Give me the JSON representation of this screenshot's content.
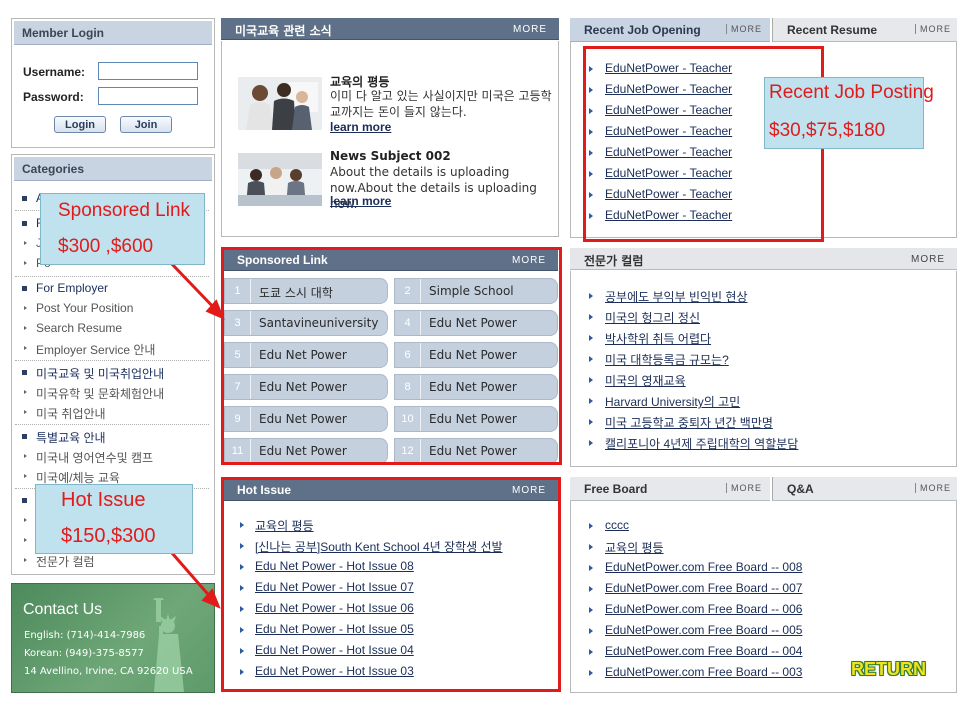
{
  "login": {
    "title": "Member Login",
    "username_label": "Username:",
    "password_label": "Password:",
    "username_value": "",
    "password_value": "",
    "login_button": "Login",
    "join_button": "Join"
  },
  "categories": {
    "title": "Categories",
    "visible_fragments": [
      "Ab",
      "F",
      "Ju",
      "Po"
    ],
    "groups": [
      {
        "title": "For Employer",
        "items": [
          "Post Your Position",
          "Search Resume",
          "Employer Service 안내"
        ]
      },
      {
        "title": "미국교육 및 미국취업안내",
        "items": [
          "미국유학 및 문화체험안내",
          "미국 취업안내"
        ]
      },
      {
        "title": "특별교육 안내",
        "items": [
          "미국내 영어연수및 캠프",
          "미국예/체능 교육"
        ]
      },
      {
        "title": "",
        "items": [
          "전문가 컬럼"
        ]
      }
    ]
  },
  "contact": {
    "title": "Contact Us",
    "english": "English: (714)-414-7986",
    "korean": "Korean: (949)-375-8577",
    "address": "14 Avellino, Irvine, CA 92620 USA"
  },
  "news": {
    "title": "미국교육 관련 소식",
    "more": "MORE",
    "items": [
      {
        "title": "교육의 평등",
        "body": "이미 다 알고 있는 사실이지만 미국은 고등학교까지는 돈이 들지 않는다.",
        "more": "learn more"
      },
      {
        "title": "News Subject 002",
        "body": "About the details is uploading now.About the details is uploading now.",
        "more": "learn more"
      }
    ]
  },
  "sponsored": {
    "title": "Sponsored Link",
    "more": "MORE",
    "cells": [
      {
        "num": "1",
        "label": "도쿄 스시 대학"
      },
      {
        "num": "2",
        "label": "Simple School"
      },
      {
        "num": "3",
        "label": "Santavineuniversity"
      },
      {
        "num": "4",
        "label": "Edu Net Power"
      },
      {
        "num": "5",
        "label": "Edu Net Power"
      },
      {
        "num": "6",
        "label": "Edu Net Power"
      },
      {
        "num": "7",
        "label": "Edu Net Power"
      },
      {
        "num": "8",
        "label": "Edu Net Power"
      },
      {
        "num": "9",
        "label": "Edu Net Power"
      },
      {
        "num": "10",
        "label": "Edu Net Power"
      },
      {
        "num": "11",
        "label": "Edu Net Power"
      },
      {
        "num": "12",
        "label": "Edu Net Power"
      }
    ]
  },
  "hot_issue": {
    "title": "Hot Issue",
    "more": "MORE",
    "items": [
      "교육의 평등",
      "[신나는 공부]South Kent School 4년 장학생 선발",
      "Edu Net Power - Hot Issue 08",
      "Edu Net Power - Hot Issue 07",
      "Edu Net Power - Hot Issue 06",
      "Edu Net Power - Hot Issue 05",
      "Edu Net Power - Hot Issue 04",
      "Edu Net Power - Hot Issue 03"
    ]
  },
  "jobs": {
    "tab_active": "Recent Job Opening",
    "tab_inactive": "Recent Resume",
    "more": "MORE",
    "items": [
      "EduNetPower - Teacher",
      "EduNetPower - Teacher",
      "EduNetPower - Teacher",
      "EduNetPower - Teacher",
      "EduNetPower - Teacher",
      "EduNetPower - Teacher",
      "EduNetPower - Teacher",
      "EduNetPower - Teacher"
    ]
  },
  "column": {
    "title": "전문가 컬럼",
    "more": "MORE",
    "items": [
      "공부에도 부익부 빈익빈 현상",
      "미국의 헝그리 정신",
      "박사학위 취득 어렵다",
      "미국 대학등록금 규모는?",
      "미국의 영재교육",
      "Harvard University의 고민",
      "미국 고등학교 중퇴자 년간 백만명",
      "캘리포니아 4년제 주립대학의 역할분담"
    ]
  },
  "board": {
    "tab_active": "Free Board",
    "tab_inactive": "Q&A",
    "more": "MORE",
    "items": [
      "cccc",
      "교육의 평등",
      "EduNetPower.com Free Board -- 008",
      "EduNetPower.com Free Board -- 007",
      "EduNetPower.com Free Board -- 006",
      "EduNetPower.com Free Board -- 005",
      "EduNetPower.com Free Board -- 004",
      "EduNetPower.com Free Board -- 003"
    ]
  },
  "annotations": {
    "sponsored": {
      "line1": "Sponsored Link",
      "line2": "$300 ,$600"
    },
    "hot_issue": {
      "line1": "Hot Issue",
      "line2": "$150,$300"
    },
    "job_posting": {
      "line1": "Recent Job Posting",
      "line2": "$30,$75,$180"
    },
    "return": "RETURN"
  },
  "colors": {
    "annotation_red": "#e21a1a",
    "header_blue": "#5e7188",
    "callout_bg": "#bfe2ee"
  }
}
